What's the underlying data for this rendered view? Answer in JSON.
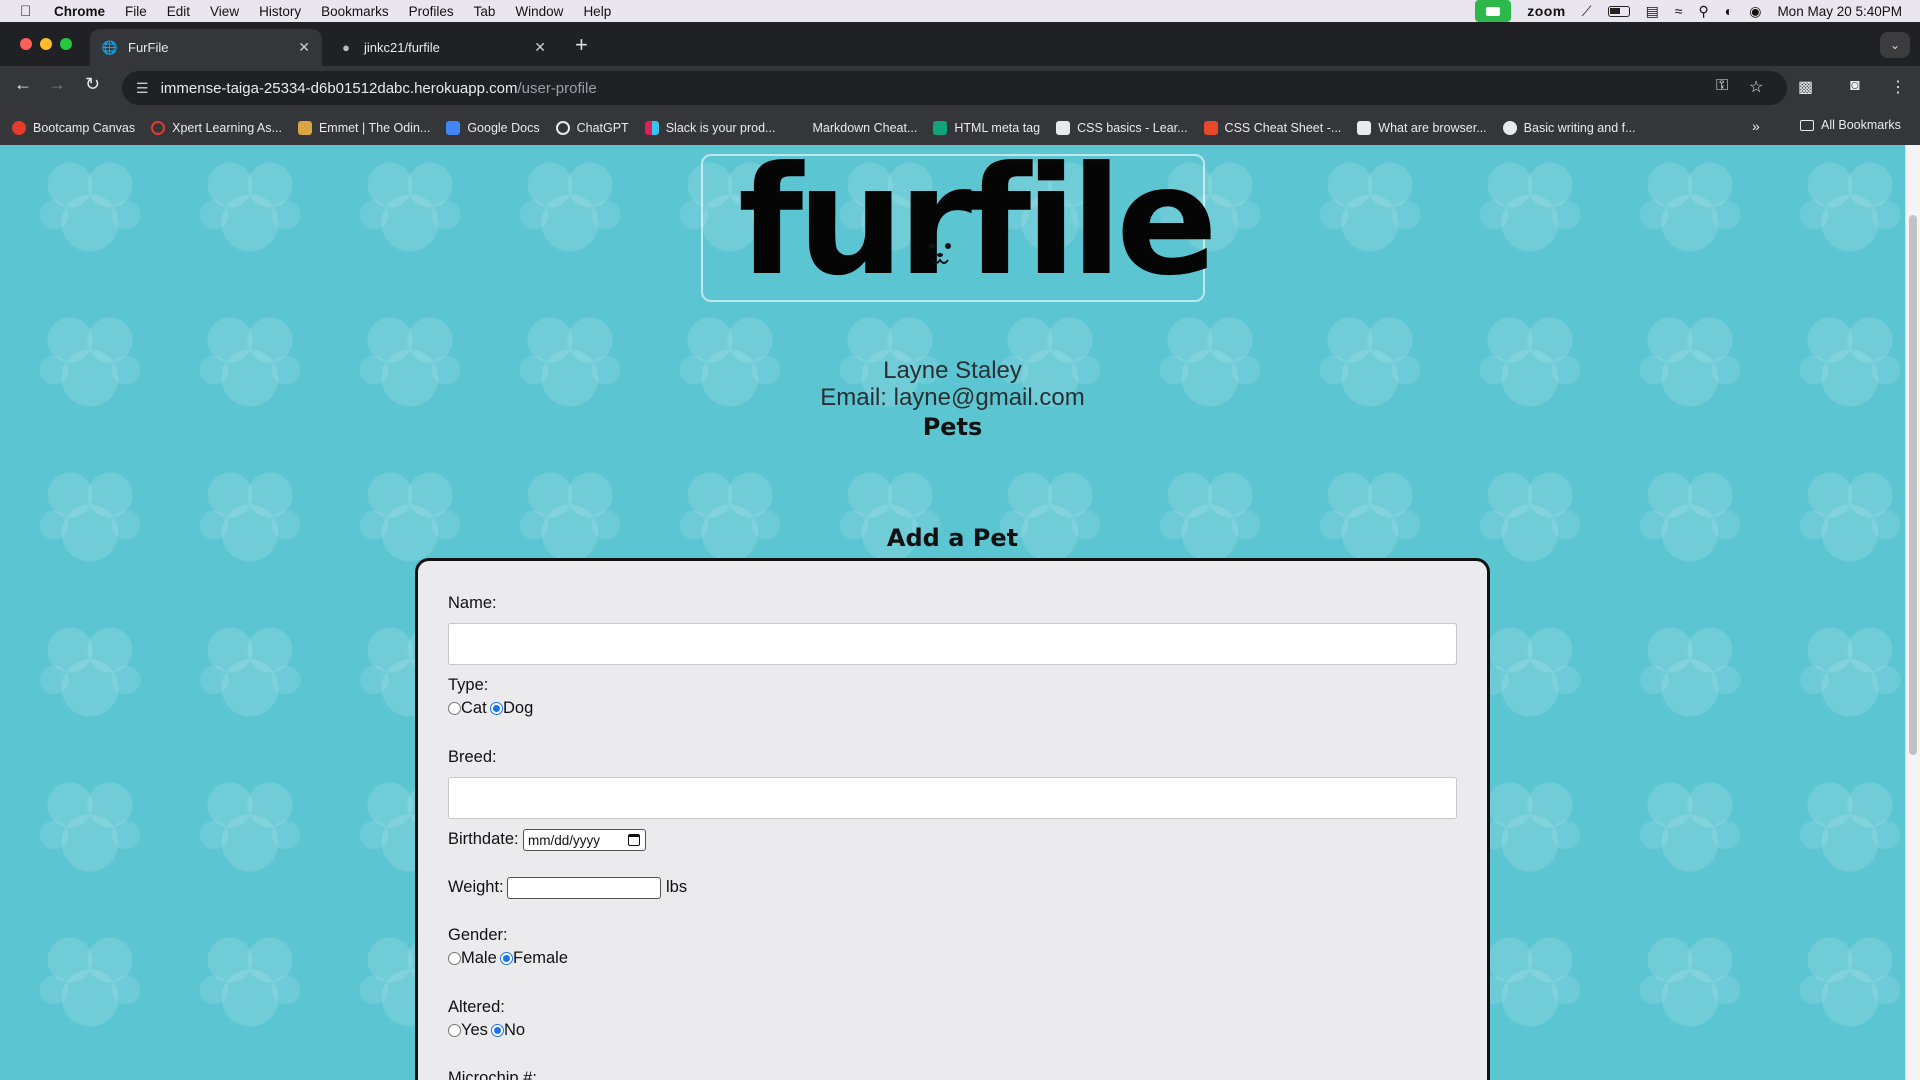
{
  "menubar": {
    "app": "Chrome",
    "items": [
      "File",
      "Edit",
      "View",
      "History",
      "Bookmarks",
      "Profiles",
      "Tab",
      "Window",
      "Help"
    ],
    "zoom_label": "zoom",
    "datetime": "Mon May 20  5:40PM"
  },
  "tabs": [
    {
      "title": "FurFile",
      "active": true
    },
    {
      "title": "jinkc21/furfile",
      "active": false
    }
  ],
  "address": {
    "domain": "immense-taiga-25334-d6b01512dabc.herokuapp.com",
    "path": "/user-profile"
  },
  "bookmarks": [
    {
      "label": "Bootcamp Canvas",
      "color": "#e23b2e"
    },
    {
      "label": "Xpert Learning As...",
      "color": "#e23b2e"
    },
    {
      "label": "Emmet | The Odin...",
      "color": "#d9a441"
    },
    {
      "label": "Google Docs",
      "color": "#4285f4"
    },
    {
      "label": "ChatGPT",
      "color": "#e8eaed"
    },
    {
      "label": "Slack is your prod...",
      "color": "#e01e5a"
    },
    {
      "label": "Markdown Cheat...",
      "color": "#35363a"
    },
    {
      "label": "HTML meta tag",
      "color": "#12a37a"
    },
    {
      "label": "CSS basics - Lear...",
      "color": "#e8eaed"
    },
    {
      "label": "CSS Cheat Sheet -...",
      "color": "#e8492a"
    },
    {
      "label": "What are browser...",
      "color": "#e8eaed"
    },
    {
      "label": "Basic writing and f...",
      "color": "#e8eaed"
    }
  ],
  "bookmarks_all": "All Bookmarks",
  "page": {
    "logo_text": "furfile",
    "user_name": "Layne Staley",
    "email_line": "Email: layne@gmail.com",
    "pets_heading": "Pets",
    "add_heading": "Add a Pet",
    "form": {
      "name_label": "Name:",
      "name_value": "",
      "type_label": "Type:",
      "type_options": [
        "Cat",
        "Dog"
      ],
      "type_selected": "Dog",
      "breed_label": "Breed:",
      "breed_value": "",
      "birthdate_label": "Birthdate:",
      "birthdate_placeholder": "mm/dd/yyyy",
      "weight_label": "Weight:",
      "weight_unit": "lbs",
      "gender_label": "Gender:",
      "gender_options": [
        "Male",
        "Female"
      ],
      "gender_selected": "Female",
      "altered_label": "Altered:",
      "altered_options": [
        "Yes",
        "No"
      ],
      "altered_selected": "No",
      "microchip_label": "Microchip #:"
    }
  },
  "colors": {
    "page_background": "#5bc5d2",
    "form_background": "#ebebee",
    "radio_accent": "#1a73e8"
  }
}
